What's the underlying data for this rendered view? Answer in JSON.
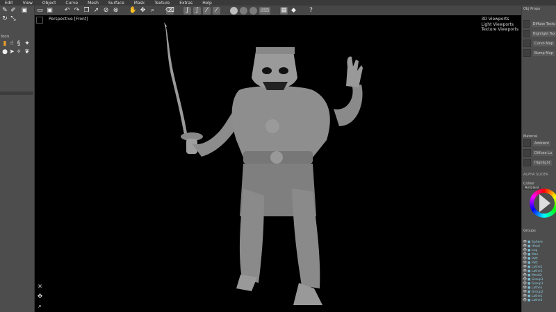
{
  "menu": [
    "Edit",
    "View",
    "Object",
    "Curve",
    "Mesh",
    "Surface",
    "Mask",
    "Texture",
    "Extras",
    "Help"
  ],
  "toolbar": {
    "icons": [
      "new-file-icon",
      "save-icon",
      "undo-icon",
      "redo-icon",
      "copy-icon",
      "select-icon",
      "paint-icon",
      "no-entry-icon",
      "close-icon",
      "pan-hand-icon",
      "move-icon",
      "zoom-icon",
      "eraser-icon",
      "curve-icon",
      "curve-alt-icon",
      "brush-icon",
      "brush-alt-icon",
      "sphere-icon",
      "sphere-dim-icon",
      "sphere-dim2-icon",
      "render-icon",
      "grid-icon",
      "diamond-icon",
      "help-icon"
    ],
    "render_label": "CURVES DISABLE"
  },
  "left_panel": {
    "title": "Tools"
  },
  "viewport": {
    "label": "Perspective [Front]",
    "menu": [
      "3D Viewports",
      "Light Viewports",
      "Texture Viewports"
    ]
  },
  "right_panel": {
    "obj_props_title": "Obj Propo",
    "obj_slots": [
      "Diffuse Textu",
      "Highlight Tex",
      "Curvo Map",
      "Bump Map"
    ],
    "material_title": "Material",
    "material_slots": [
      "Ambient",
      "Diffuse Lu",
      "Highlight"
    ],
    "tabs": "ALPHA SLIDER",
    "colour_title": "Colour",
    "colour_value": "Ambient",
    "groups_title": "Groups",
    "groups": [
      "Sphere",
      "Head",
      "Leg",
      "Man",
      "Patt",
      "Patt",
      "Lathe1",
      "Lathe1",
      "Mesh2",
      "Group1",
      "Group1",
      "Lathe1",
      "Group2",
      "Lathe1",
      "Lathe2"
    ]
  }
}
